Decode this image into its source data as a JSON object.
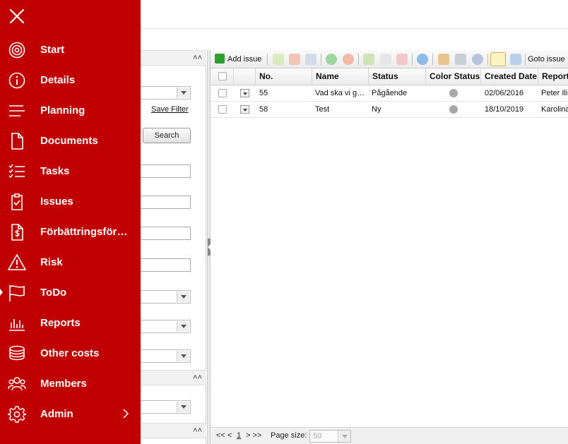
{
  "menu": {
    "items": [
      {
        "label": "Start",
        "icon": "target-icon"
      },
      {
        "label": "Details",
        "icon": "info-icon"
      },
      {
        "label": "Planning",
        "icon": "lines-icon"
      },
      {
        "label": "Documents",
        "icon": "document-icon"
      },
      {
        "label": "Tasks",
        "icon": "checklist-icon"
      },
      {
        "label": "Issues",
        "icon": "clipboard-check-icon"
      },
      {
        "label": "Förbättringsför…",
        "icon": "dollar-document-icon"
      },
      {
        "label": "Risk",
        "icon": "warning-icon"
      },
      {
        "label": "ToDo",
        "icon": "flag-icon"
      },
      {
        "label": "Reports",
        "icon": "bar-chart-icon"
      },
      {
        "label": "Other costs",
        "icon": "coins-icon"
      },
      {
        "label": "Members",
        "icon": "people-icon"
      },
      {
        "label": "Admin",
        "icon": "gear-icon"
      }
    ],
    "active_item": "ToDo",
    "accent_color": "#c00000"
  },
  "filter": {
    "save_filter_label": "Save Filter",
    "search_label": "Search"
  },
  "toolbar": {
    "add_issue_label": "Add issue",
    "goto_issue_label": "Goto issue"
  },
  "grid": {
    "columns": [
      "No.",
      "Name",
      "Status",
      "Color Status",
      "Created Date",
      "Reporte"
    ],
    "rows": [
      {
        "no": "55",
        "name": "Vad ska vi g…",
        "status": "Pågående",
        "color_status": "grey",
        "created": "02/06/2016",
        "reporter": "Peter Ili"
      },
      {
        "no": "58",
        "name": "Test",
        "status": "Ny",
        "color_status": "grey",
        "created": "18/10/2019",
        "reporter": "Karolina"
      }
    ]
  },
  "pager": {
    "first_prev": "<< <",
    "current_page": "1",
    "next_last": "> >>",
    "page_size_label": "Page size:",
    "page_size_value": "50"
  }
}
